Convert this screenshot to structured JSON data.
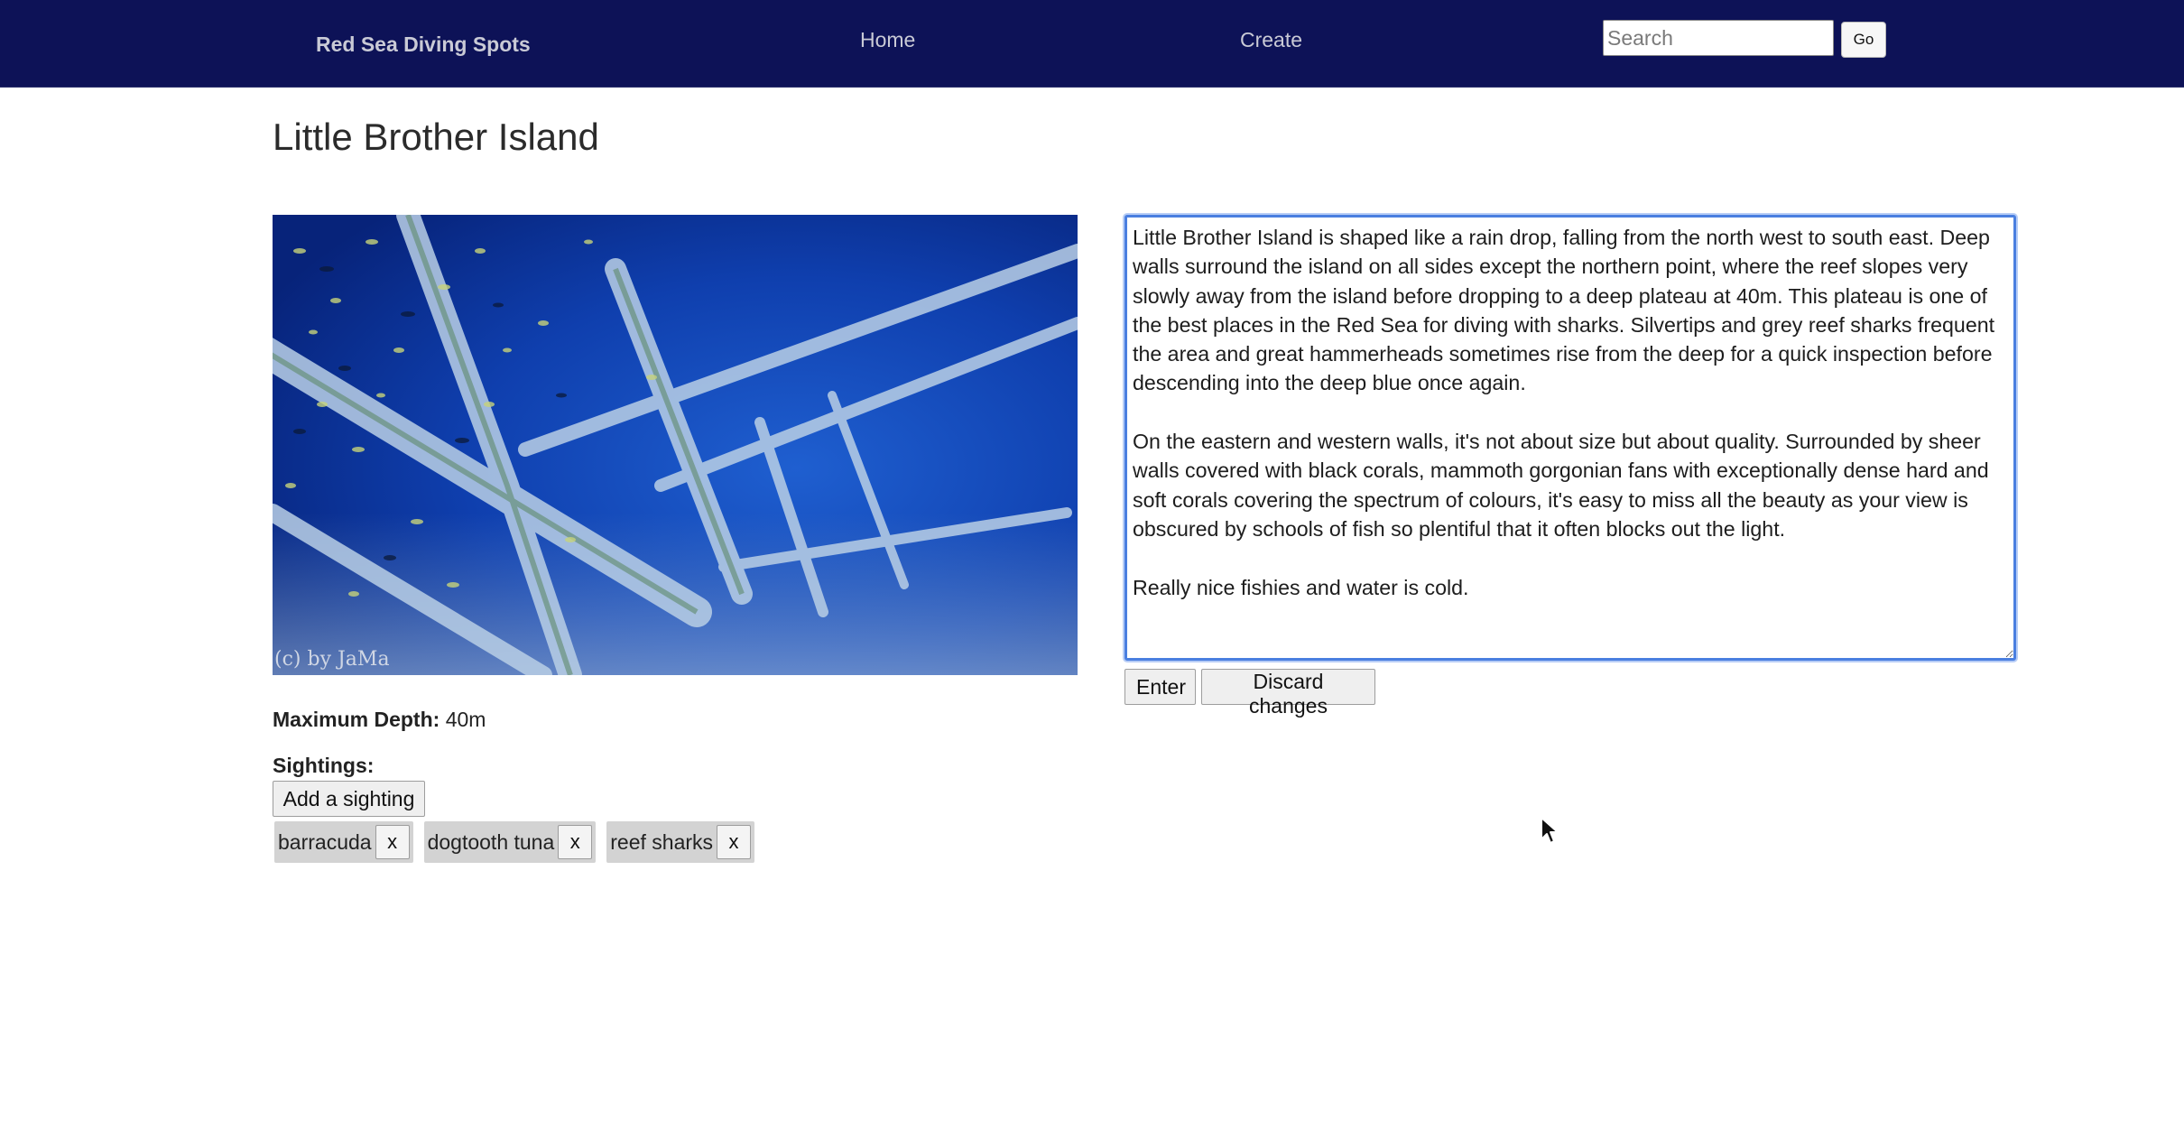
{
  "navbar": {
    "brand": "Red Sea Diving Spots",
    "links": [
      {
        "label": "Home"
      },
      {
        "label": "Create"
      }
    ],
    "search": {
      "placeholder": "Search",
      "value": ""
    },
    "go_label": "Go"
  },
  "page": {
    "title": "Little Brother Island",
    "photo_credit": "(c) by JaMa",
    "description": "Little Brother Island is shaped like a rain drop, falling from the north west to south east. Deep walls surround the island on all sides except the northern point, where the reef slopes very slowly away from the island before dropping to a deep plateau at 40m. This plateau is one of the best places in the Red Sea for diving with sharks. Silvertips and grey reef sharks frequent the area and great hammerheads sometimes rise from the deep for a quick inspection before descending into the deep blue once again.\n\nOn the eastern and western walls, it's not about size but about quality. Surrounded by sheer walls covered with black corals, mammoth gorgonian fans with exceptionally dense hard and soft corals covering the spectrum of colours, it's easy to miss all the beauty as your view is obscured by schools of fish so plentiful that it often blocks out the light.\n\nReally nice fishies and water is cold.",
    "enter_label": "Enter",
    "discard_label": "Discard changes",
    "depth_label": "Maximum Depth:",
    "depth_value": "40m",
    "sightings_label": "Sightings:",
    "add_sighting_label": "Add a sighting",
    "sightings": [
      {
        "name": "barracuda",
        "remove": "x"
      },
      {
        "name": "dogtooth tuna",
        "remove": "x"
      },
      {
        "name": "reef sharks",
        "remove": "x"
      }
    ]
  },
  "colors": {
    "navbar_bg": "#0d1257",
    "focus_ring": "#4a7fe0",
    "tag_bg": "#d3d3d3"
  }
}
